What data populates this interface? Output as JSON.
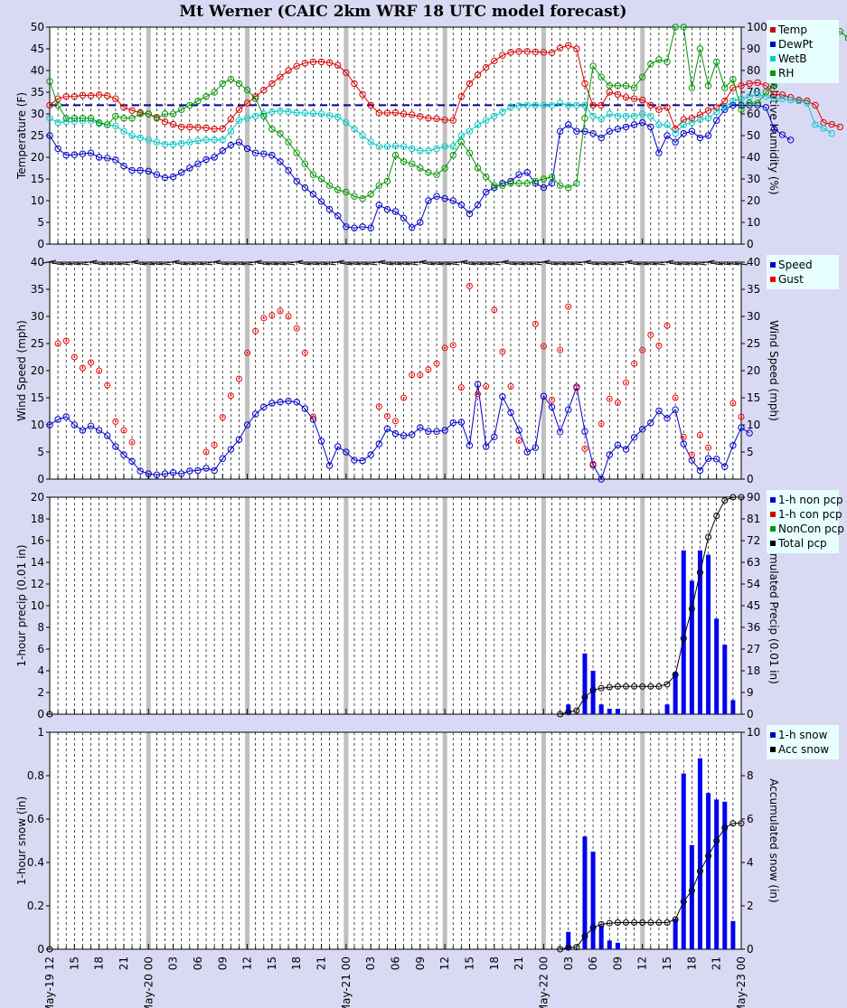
{
  "title": "Mt Werner (CAIC 2km WRF 18 UTC model forecast)",
  "colors": {
    "background": "#d9d9f3",
    "plot_bg": "#ffffff",
    "legend_bg": "#e8ffff",
    "temp": "#dd0000",
    "dewpt": "#0000cc",
    "wetb": "#00cccc",
    "rh": "#009900",
    "freezing_line": "#000099",
    "day_line": "#c0c0c0"
  },
  "time_axis": {
    "hours_start": 0,
    "hours_end": 84,
    "tick_labels": [
      "May-19 12",
      "15",
      "18",
      "21",
      "May-20 00",
      "03",
      "06",
      "09",
      "12",
      "15",
      "18",
      "21",
      "May-21 00",
      "03",
      "06",
      "09",
      "12",
      "15",
      "18",
      "21",
      "May-22 00",
      "03",
      "06",
      "09",
      "12",
      "15",
      "18",
      "21",
      "May-23 00"
    ]
  },
  "chart_data": [
    {
      "type": "line",
      "ylabel": "Temperature (F)",
      "ylim": [
        0,
        50
      ],
      "yticks": [
        "0",
        "5",
        "10",
        "15",
        "20",
        "25",
        "30",
        "35",
        "40",
        "45",
        "50"
      ],
      "y2label": "Relative Humidity (%)",
      "y2lim": [
        0,
        100
      ],
      "y2ticks": [
        "0",
        "10",
        "20",
        "30",
        "40",
        "50",
        "60",
        "70",
        "80",
        "90",
        "100"
      ],
      "freezing_line": 32,
      "legend": [
        "Temp",
        "DewPt",
        "WetB",
        "RH"
      ],
      "series": [
        {
          "name": "Temp",
          "axis": "left",
          "values": [
            32,
            33.5,
            34,
            34,
            34.3,
            34.2,
            34.4,
            34.2,
            33.5,
            31.5,
            30.8,
            30.3,
            30,
            29.2,
            28.2,
            27.6,
            27,
            27,
            26.9,
            26.8,
            26.5,
            26.6,
            28.8,
            31,
            32.5,
            34,
            35.5,
            37,
            38.5,
            40,
            41,
            41.7,
            42,
            42,
            41.8,
            41.2,
            39.5,
            37,
            34.5,
            32,
            30.2,
            30.2,
            30.3,
            30,
            29.8,
            29.4,
            29,
            28.9,
            28.6,
            28.5,
            34,
            37,
            39,
            40.7,
            42.2,
            43.5,
            44.2,
            44.4,
            44.4,
            44.3,
            44.2,
            44.1,
            45.2,
            45.8,
            45,
            37,
            32,
            32,
            35,
            34.5,
            33.8,
            33.5,
            33.2,
            32,
            31,
            31.5,
            26.5,
            28.7,
            29,
            29.8,
            30.8,
            31.5,
            33,
            36,
            36.5,
            37,
            37.2,
            36.5,
            34.5,
            34.4,
            33.8,
            33.2,
            33,
            32,
            28,
            27.6,
            27
          ]
        },
        {
          "name": "DewPt",
          "axis": "left",
          "values": [
            25,
            22,
            20.5,
            20.6,
            20.8,
            21,
            20,
            19.8,
            19.4,
            18,
            17,
            17,
            16.8,
            16,
            15.3,
            15.5,
            16.5,
            17.5,
            18.5,
            19.5,
            20,
            21.5,
            22.8,
            23.5,
            22,
            21,
            20.8,
            20.5,
            19,
            17,
            14.5,
            13,
            11.5,
            9.8,
            8,
            6.5,
            4,
            3.7,
            4,
            3.7,
            9,
            8,
            7.5,
            6,
            3.8,
            5,
            10,
            11,
            10.5,
            10,
            9,
            7,
            9,
            12,
            13,
            14,
            14.5,
            16,
            16.5,
            14,
            13,
            14,
            26,
            27.5,
            26,
            26,
            25.5,
            24.5,
            26,
            26.5,
            27,
            27.5,
            28,
            27,
            21,
            25,
            23.5,
            25.5,
            26,
            24.5,
            25,
            28.5,
            31,
            32,
            32,
            32,
            32,
            31.5,
            26.5,
            25.2,
            24
          ]
        },
        {
          "name": "WetB",
          "axis": "left",
          "values": [
            29,
            28,
            28.2,
            28.3,
            28.4,
            28.4,
            27.8,
            27.5,
            27.2,
            26,
            25,
            24.5,
            24,
            23.5,
            23,
            23,
            23.2,
            23.5,
            23.8,
            24,
            24,
            24,
            26,
            28.5,
            29,
            29.5,
            30,
            30.5,
            30.7,
            30.5,
            30.3,
            30.2,
            30.1,
            30,
            29.6,
            29.3,
            28,
            26.5,
            25,
            23.5,
            22.5,
            22.5,
            22.6,
            22.5,
            22,
            21.5,
            21.5,
            22,
            22.5,
            22.5,
            25,
            26,
            27.5,
            28.5,
            29.5,
            30.5,
            31.5,
            31.9,
            32,
            32,
            32,
            32,
            32.5,
            32,
            32,
            32,
            29.5,
            28.8,
            30,
            29.5,
            29.5,
            29.5,
            30,
            29.5,
            27.5,
            27.5,
            25.5,
            27.5,
            28,
            28.7,
            29,
            30.5,
            31.5,
            33,
            33.5,
            34,
            34.5,
            34,
            33.5,
            33.5,
            33.2,
            33,
            32.5,
            27.5,
            26.7,
            25.5
          ]
        },
        {
          "name": "RH",
          "axis": "right",
          "values": [
            75,
            64,
            58,
            58,
            58,
            58,
            56,
            55,
            59,
            58,
            58,
            60,
            60,
            58,
            60,
            60,
            62,
            64,
            66,
            68,
            70,
            74,
            76,
            74,
            71,
            67,
            59,
            53,
            51,
            47,
            42,
            37,
            32,
            30,
            27,
            25,
            24,
            22,
            21,
            23,
            27,
            29,
            41,
            38,
            37,
            35,
            33,
            32,
            35,
            41,
            47,
            42,
            35,
            31,
            27,
            27,
            28,
            28,
            28,
            29,
            30,
            31,
            27,
            26,
            28,
            58,
            82,
            77,
            73,
            73,
            73,
            72,
            77,
            83,
            85,
            84,
            100,
            100,
            72,
            90,
            73,
            84,
            72,
            76,
            62,
            65,
            65,
            70,
            73,
            90,
            92,
            91,
            95,
            93,
            97,
            96,
            98,
            95,
            90,
            90
          ]
        }
      ]
    },
    {
      "type": "scatter",
      "ylabel": "Wind Speed (mph)",
      "ylim": [
        0,
        40
      ],
      "yticks": [
        "0",
        "5",
        "10",
        "15",
        "20",
        "25",
        "30",
        "35",
        "40"
      ],
      "y2label": "Wind Speed (mph)",
      "legend": [
        "Speed",
        "Gust"
      ],
      "series": [
        {
          "name": "Speed",
          "values": [
            10,
            11,
            11.5,
            10,
            9,
            9.8,
            9,
            8,
            6,
            4.5,
            3.3,
            1.5,
            1,
            0.8,
            1,
            1.2,
            1,
            1.5,
            1.6,
            2,
            1.6,
            3.8,
            5.5,
            7.3,
            10,
            12,
            13.3,
            14,
            14.2,
            14.4,
            14.2,
            13,
            11,
            7,
            2.5,
            6,
            5,
            3.5,
            3.4,
            4.5,
            6.5,
            9.3,
            8.4,
            8,
            8.2,
            9.5,
            8.8,
            8.8,
            9,
            10.4,
            10.5,
            6.2,
            17.5,
            6,
            7.8,
            15.2,
            12.3,
            9,
            5,
            5.8,
            15.3,
            13.3,
            8.7,
            12.8,
            17,
            8.8,
            2.6,
            0,
            4.5,
            6.3,
            5.5,
            7.7,
            9.2,
            10.4,
            12.6,
            11.2,
            12.8,
            6.5,
            3.5,
            1.6,
            3.8,
            3.7,
            2.3,
            6.2,
            9.5,
            8.5
          ]
        },
        {
          "name": "Gust",
          "values": [
            null,
            25,
            25.5,
            22.5,
            20.5,
            21.5,
            20,
            17.3,
            10.6,
            9,
            6.8,
            null,
            null,
            null,
            null,
            null,
            null,
            null,
            null,
            5,
            6.3,
            11.4,
            15.4,
            18.5,
            23.3,
            27.3,
            29.7,
            30.2,
            31,
            30,
            27.8,
            23.3,
            11.5,
            null,
            null,
            null,
            null,
            null,
            null,
            null,
            13.4,
            11.6,
            10.7,
            15,
            19.2,
            19.2,
            20.2,
            21.3,
            24.2,
            24.7,
            16.9,
            35.6,
            15.7,
            17.1,
            31.2,
            23.5,
            17.1,
            7.1,
            null,
            28.6,
            24.5,
            14.6,
            23.8,
            31.8,
            16.8,
            5.6,
            2.8,
            10.2,
            14.8,
            14.1,
            17.8,
            21.3,
            23.8,
            26.6,
            24.6,
            28.3,
            15,
            7.8,
            4.5,
            8.1,
            5.8,
            null,
            null,
            14,
            11.5
          ]
        }
      ]
    },
    {
      "type": "bar",
      "ylabel": "1-hour precip (0.01 in)",
      "ylim": [
        0,
        20
      ],
      "yticks": [
        "0",
        "2",
        "4",
        "6",
        "8",
        "10",
        "12",
        "14",
        "16",
        "18",
        "20"
      ],
      "y2label": "Accumulated Precip (0.01 in)",
      "y2lim": [
        0,
        90
      ],
      "y2ticks": [
        "0",
        "9",
        "18",
        "27",
        "36",
        "45",
        "54",
        "63",
        "72",
        "81",
        "90"
      ],
      "legend": [
        "1-h non pcp",
        "1-h con pcp",
        "NonCon pcp",
        "Total pcp"
      ],
      "bars": [
        {
          "hour": 63,
          "value": 0.9
        },
        {
          "hour": 65,
          "value": 5.6
        },
        {
          "hour": 66,
          "value": 4
        },
        {
          "hour": 67,
          "value": 0.9
        },
        {
          "hour": 68,
          "value": 0.5
        },
        {
          "hour": 69,
          "value": 0.5
        },
        {
          "hour": 75,
          "value": 0.9
        },
        {
          "hour": 76,
          "value": 3.9
        },
        {
          "hour": 77,
          "value": 15.1
        },
        {
          "hour": 78,
          "value": 12.3
        },
        {
          "hour": 79,
          "value": 15.1
        },
        {
          "hour": 80,
          "value": 14.7
        },
        {
          "hour": 81,
          "value": 8.8
        },
        {
          "hour": 82,
          "value": 6.4
        },
        {
          "hour": 83,
          "value": 1.3
        }
      ],
      "series": [
        {
          "name": "Total pcp",
          "axis": "right",
          "points": [
            [
              0,
              0
            ],
            [
              62,
              0
            ],
            [
              63,
              0.9
            ],
            [
              64,
              1.5
            ],
            [
              65,
              7
            ],
            [
              66,
              10
            ],
            [
              67,
              10.8
            ],
            [
              68,
              11.2
            ],
            [
              69,
              11.5
            ],
            [
              70,
              11.5
            ],
            [
              71,
              11.5
            ],
            [
              72,
              11.5
            ],
            [
              73,
              11.5
            ],
            [
              74,
              11.5
            ],
            [
              75,
              12.4
            ],
            [
              76,
              16.3
            ],
            [
              77,
              31.4
            ],
            [
              78,
              43.7
            ],
            [
              79,
              58.8
            ],
            [
              80,
              73.5
            ],
            [
              81,
              82.3
            ],
            [
              82,
              88.7
            ],
            [
              83,
              90
            ],
            [
              84,
              90
            ]
          ]
        }
      ]
    },
    {
      "type": "bar",
      "ylabel": "1-hour snow (in)",
      "ylim": [
        0,
        1
      ],
      "yticks": [
        "0",
        "0.2",
        "0.4",
        "0.6",
        "0.8",
        "1"
      ],
      "y2label": "Accumulated snow (in)",
      "y2lim": [
        0,
        10
      ],
      "y2ticks": [
        "0",
        "2",
        "4",
        "6",
        "8",
        "10"
      ],
      "legend": [
        "1-h snow",
        "Acc snow"
      ],
      "bars": [
        {
          "hour": 63,
          "value": 0.08
        },
        {
          "hour": 65,
          "value": 0.52
        },
        {
          "hour": 66,
          "value": 0.45
        },
        {
          "hour": 67,
          "value": 0.11
        },
        {
          "hour": 68,
          "value": 0.04
        },
        {
          "hour": 69,
          "value": 0.03
        },
        {
          "hour": 76,
          "value": 0.14
        },
        {
          "hour": 77,
          "value": 0.81
        },
        {
          "hour": 78,
          "value": 0.48
        },
        {
          "hour": 79,
          "value": 0.88
        },
        {
          "hour": 80,
          "value": 0.72
        },
        {
          "hour": 81,
          "value": 0.69
        },
        {
          "hour": 82,
          "value": 0.68
        },
        {
          "hour": 83,
          "value": 0.13
        }
      ],
      "series": [
        {
          "name": "Acc snow",
          "axis": "right",
          "points": [
            [
              0,
              0
            ],
            [
              62,
              0
            ],
            [
              63,
              0.08
            ],
            [
              64,
              0.1
            ],
            [
              65,
              0.6
            ],
            [
              66,
              1
            ],
            [
              67,
              1.15
            ],
            [
              68,
              1.2
            ],
            [
              69,
              1.23
            ],
            [
              70,
              1.23
            ],
            [
              71,
              1.23
            ],
            [
              72,
              1.23
            ],
            [
              73,
              1.23
            ],
            [
              74,
              1.23
            ],
            [
              75,
              1.23
            ],
            [
              76,
              1.37
            ],
            [
              77,
              2.2
            ],
            [
              78,
              2.7
            ],
            [
              79,
              3.6
            ],
            [
              80,
              4.3
            ],
            [
              81,
              5
            ],
            [
              82,
              5.6
            ],
            [
              83,
              5.8
            ],
            [
              84,
              5.8
            ]
          ]
        }
      ]
    }
  ]
}
